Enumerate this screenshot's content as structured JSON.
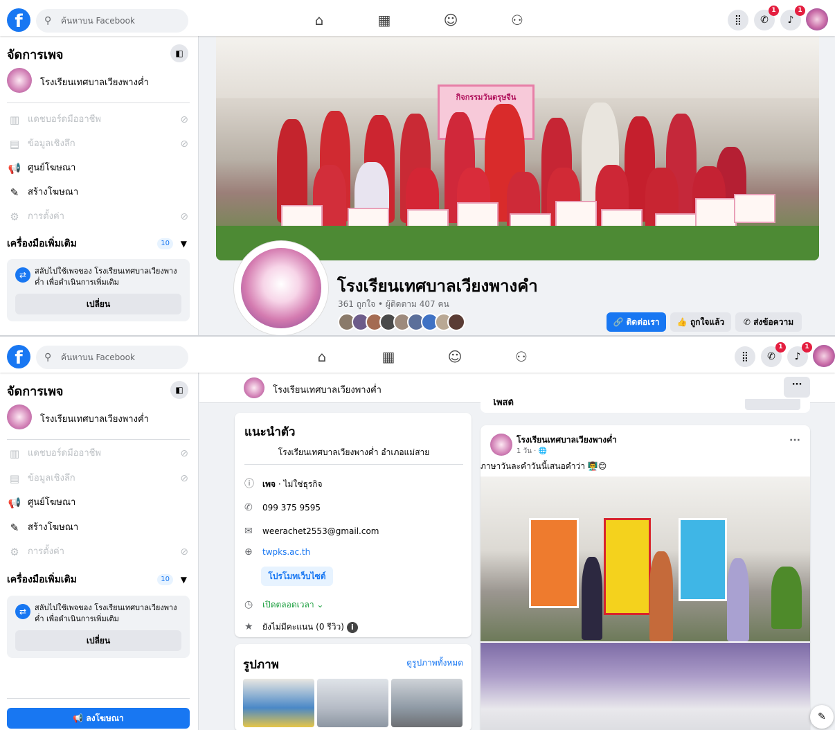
{
  "topbar": {
    "search_placeholder": "ค้นหาบน Facebook",
    "notifications": {
      "messenger_count": "1",
      "alerts_count": "1"
    }
  },
  "sidebar": {
    "title": "จัดการเพจ",
    "page_name": "โรงเรียนเทศบาลเวียงพางค่ำ",
    "items": [
      {
        "label": "แดชบอร์ดมืออาชีพ",
        "icon": "dashboard-icon",
        "disabled": true
      },
      {
        "label": "ข้อมูลเชิงลึก",
        "icon": "insights-icon",
        "disabled": true
      },
      {
        "label": "ศูนย์โฆษณา",
        "icon": "megaphone-icon",
        "disabled": false
      },
      {
        "label": "สร้างโฆษณา",
        "icon": "edit-icon",
        "disabled": false
      },
      {
        "label": "การตั้งค่า",
        "icon": "gear-icon",
        "disabled": true
      }
    ],
    "more_tools_label": "เครื่องมือเพิ่มเติม",
    "more_tools_count": "10",
    "switch_text": "สลับไปใช้เพจของ โรงเรียนเทศบาลเวียงพางค่ำ เพื่อดำเนินการเพิ่มเติม",
    "switch_button": "เปลี่ยน",
    "advertise_button": "ลงโฆษณา"
  },
  "header": {
    "page_title": "โรงเรียนเทศบาลเวียงพางคำ",
    "stats": "361 ถูกใจ • ผู้ติดตาม 407 คน",
    "buttons": {
      "contact": "ติดต่อเรา",
      "liked": "ถูกใจแล้ว",
      "message": "ส่งข้อความ"
    },
    "cover_banner": "กิจกรรมวันตรุษจีน"
  },
  "pagebar": {
    "name": "โรงเรียนเทศบาลเวียงพางค่ำ",
    "more": "···"
  },
  "intro": {
    "title": "แนะนำตัว",
    "description": "โรงเรียนเทศบาลเวียงพางค่ำ อำเภอแม่สาย",
    "category": "เพจ · ไม่ใช่ธุรกิจ",
    "category_bold": "เพจ",
    "category_rest": " · ไม่ใช่ธุรกิจ",
    "phone": "099 375 9595",
    "email": "weerachet2553@gmail.com",
    "website": "twpks.ac.th",
    "promote_button": "โปรโมทเว็บไซต์",
    "hours": "เปิดตลอดเวลา",
    "rating": "ยังไม่มีคะแนน (0 รีวิว)"
  },
  "photos": {
    "title": "รูปภาพ",
    "see_all": "ดูรูปภาพทั้งหมด"
  },
  "post": {
    "author": "โรงเรียนเทศบาลเวียงพางค่ำ",
    "time": "1 วัน · 🌐",
    "caption": "ภาษาวันละคำวันนี้เสนอคำว่า",
    "more": "···",
    "section_title": "โพสต์"
  },
  "colors": {
    "facebook_blue": "#1877f2",
    "badge_red": "#e41e3f"
  }
}
